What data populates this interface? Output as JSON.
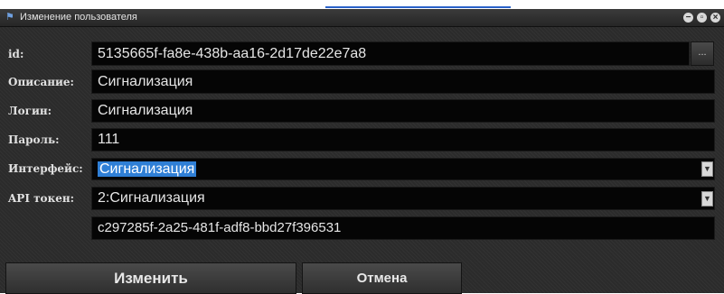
{
  "window": {
    "title": "Изменение пользователя"
  },
  "form": {
    "id": {
      "label": "id:",
      "value": "5135665f-fa8e-438b-aa16-2d17de22e7a8",
      "browse_label": "..."
    },
    "description": {
      "label": "Описание:",
      "value": "Сигнализация"
    },
    "login": {
      "label": "Логин:",
      "value": "Сигнализация"
    },
    "password": {
      "label": "Пароль:",
      "value": "111"
    },
    "interface": {
      "label": "Интерфейс:",
      "value": "Сигнализация"
    },
    "api_token": {
      "label": "API токен:",
      "value": "2:Сигнализация",
      "token_value": "c297285f-2a25-481f-adf8-bbd27f396531"
    }
  },
  "buttons": {
    "change_label": "Изменить",
    "cancel_label": "Отмена"
  },
  "icons": {
    "app": "flag-icon",
    "minimize": "minimize-icon",
    "restore": "restore-icon",
    "close": "close-icon",
    "dropdown": "chevron-down-icon"
  },
  "colors": {
    "selection": "#2f7fd6",
    "background": "#2b2b2b",
    "field": "#050505"
  }
}
